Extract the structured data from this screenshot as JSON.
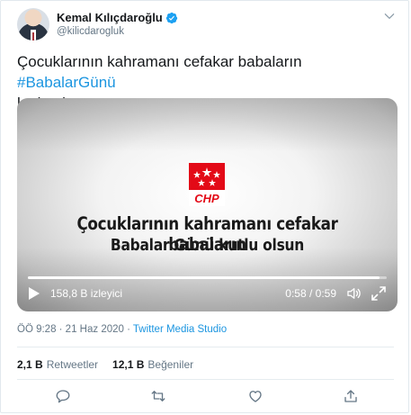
{
  "author": {
    "display_name": "Kemal Kılıçdaroğlu",
    "handle": "@kilicdarogluk"
  },
  "tweet": {
    "text_before": "Çocuklarının kahramanı cefakar babaların ",
    "hashtag": "#BabalarGünü",
    "text_after": "kutlu olsun."
  },
  "video": {
    "logo_text": "CHP",
    "caption_line1": "Çocuklarının kahramanı cefakar babaların",
    "caption_line2": "Babalar Günü kutlu olsun",
    "views": "158,8 B izleyici",
    "time": "0:58 / 0:59",
    "progress": 0.98
  },
  "meta": {
    "timestamp": "ÖÖ 9:28 · 21 Haz 2020",
    "separator": " · ",
    "source": "Twitter Media Studio"
  },
  "stats": {
    "retweets_count": "2,1 B",
    "retweets_label": "Retweetler",
    "likes_count": "12,1 B",
    "likes_label": "Beğeniler"
  },
  "icons": {
    "verified": "verified-badge-icon",
    "caret": "chevron-down-icon",
    "play": "play-icon",
    "mute": "volume-icon",
    "fullscreen": "fullscreen-icon",
    "reply": "reply-icon",
    "retweet": "retweet-icon",
    "like": "heart-icon",
    "share": "share-icon"
  },
  "colors": {
    "link": "#1b95e0",
    "secondary_text": "#657786",
    "chp_red": "#e30a17"
  }
}
